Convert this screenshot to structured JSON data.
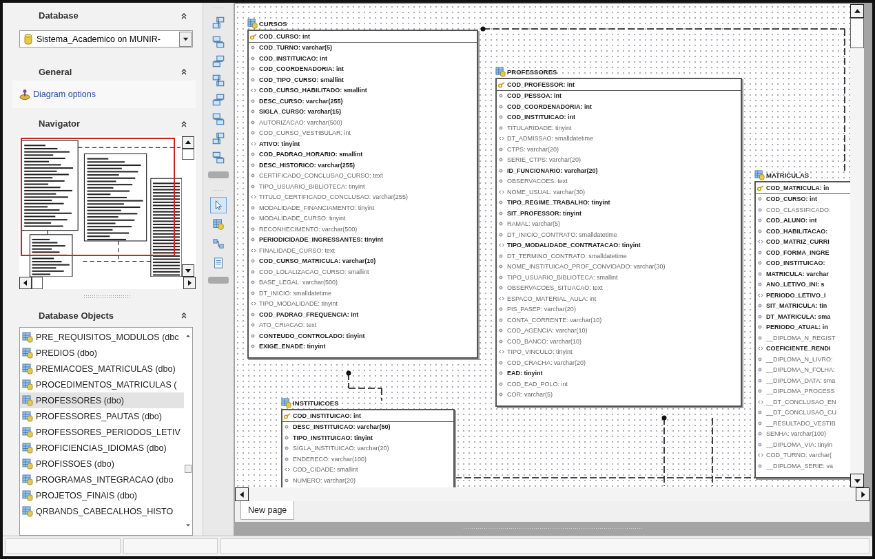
{
  "database_panel": {
    "title": "Database",
    "selected_database": "Sistema_Academico on MUNIR-"
  },
  "general_panel": {
    "title": "General",
    "link": "Diagram options"
  },
  "navigator_panel": {
    "title": "Navigator"
  },
  "objects_panel": {
    "title": "Database Objects",
    "items": [
      {
        "label": "PRE_REQUISITOS_MODULOS (dbc",
        "selected": false
      },
      {
        "label": "PREDIOS (dbo)",
        "selected": false
      },
      {
        "label": "PREMIACOES_MATRICULAS (dbo)",
        "selected": false
      },
      {
        "label": "PROCEDIMENTOS_MATRICULAS (",
        "selected": false
      },
      {
        "label": "PROFESSORES (dbo)",
        "selected": true
      },
      {
        "label": "PROFESSORES_PAUTAS (dbo)",
        "selected": false
      },
      {
        "label": "PROFESSORES_PERIODOS_LETIV",
        "selected": false
      },
      {
        "label": "PROFICIENCIAS_IDIOMAS (dbo)",
        "selected": false
      },
      {
        "label": "PROFISSOES (dbo)",
        "selected": false
      },
      {
        "label": "PROGRAMAS_INTEGRACAO (dbo",
        "selected": false
      },
      {
        "label": "PROJETOS_FINAIS (dbo)",
        "selected": false
      },
      {
        "label": "QRBANDS_CABECALHOS_HISTO",
        "selected": false
      }
    ]
  },
  "tools": [
    {
      "kind": "pointer",
      "selected": true
    },
    {
      "kind": "table",
      "selected": false
    },
    {
      "kind": "relation",
      "selected": false
    },
    {
      "kind": "note",
      "selected": false
    }
  ],
  "diagram": {
    "tables": [
      {
        "name": "CURSOS",
        "fields": [
          {
            "text": "COD_CURSO: int",
            "kind": "key",
            "bold": true
          },
          {
            "text": "COD_TURNO: varchar(5)",
            "kind": "dot",
            "bold": true
          },
          {
            "text": "COD_INSTITUICAO: int",
            "kind": "dot",
            "bold": true
          },
          {
            "text": "COD_COORDENADORIA: int",
            "kind": "dot",
            "bold": true
          },
          {
            "text": "COD_TIPO_CURSO: smallint",
            "kind": "dot",
            "bold": true
          },
          {
            "text": "COD_CURSO_HABILITADO: smallint",
            "kind": "chevrons",
            "bold": true
          },
          {
            "text": "DESC_CURSO: varchar(255)",
            "kind": "dot",
            "bold": true
          },
          {
            "text": "SIGLA_CURSO: varchar(15)",
            "kind": "dot",
            "bold": true
          },
          {
            "text": "AUTORIZACAO: varchar(500)",
            "kind": "dot",
            "bold": false
          },
          {
            "text": "COD_CURSO_VESTIBULAR: int",
            "kind": "dot",
            "bold": false
          },
          {
            "text": "ATIVO: tinyint",
            "kind": "chevrons",
            "bold": true
          },
          {
            "text": "COD_PADRAO_HORARIO: smallint",
            "kind": "dot",
            "bold": true
          },
          {
            "text": "DESC_HISTORICO: varchar(255)",
            "kind": "dot",
            "bold": true
          },
          {
            "text": "CERTIFICADO_CONCLUSAO_CURSO: text",
            "kind": "dot",
            "bold": false
          },
          {
            "text": "TIPO_USUARIO_BIBLIOTECA: tinyint",
            "kind": "dot",
            "bold": false
          },
          {
            "text": "TITULO_CERTIFICADO_CONCLUSAO: varchar(255)",
            "kind": "chevrons",
            "bold": false
          },
          {
            "text": "MODALIDADE_FINANCIAMENTO: tinyint",
            "kind": "dot",
            "bold": false
          },
          {
            "text": "MODALIDADE_CURSO: tinyint",
            "kind": "dot",
            "bold": false
          },
          {
            "text": "RECONHECIMENTO: varchar(500)",
            "kind": "dot",
            "bold": false
          },
          {
            "text": "PERIODICIDADE_INGRESSANTES: tinyint",
            "kind": "dot",
            "bold": true
          },
          {
            "text": "FINALIDADE_CURSO: text",
            "kind": "chevrons",
            "bold": false
          },
          {
            "text": "COD_CURSO_MATRICULA: varchar(10)",
            "kind": "dot",
            "bold": true
          },
          {
            "text": "COD_LOLALIZACAO_CURSO: smallint",
            "kind": "dot",
            "bold": false
          },
          {
            "text": "BASE_LEGAL: varchar(500)",
            "kind": "dot",
            "bold": false
          },
          {
            "text": "DT_INICIO: smalldatetime",
            "kind": "dot",
            "bold": false
          },
          {
            "text": "TIPO_MODALIDADE: tinyint",
            "kind": "chevrons",
            "bold": false
          },
          {
            "text": "COD_PADRAO_FREQUENCIA: int",
            "kind": "dot",
            "bold": true
          },
          {
            "text": "ATO_CRIACAO: text",
            "kind": "dot",
            "bold": false
          },
          {
            "text": "CONTEUDO_CONTROLADO: tinyint",
            "kind": "dot",
            "bold": true
          },
          {
            "text": "EXIGE_ENADE: tinyint",
            "kind": "dot",
            "bold": true
          }
        ]
      },
      {
        "name": "PROFESSORES",
        "fields": [
          {
            "text": "COD_PROFESSOR: int",
            "kind": "key",
            "bold": true
          },
          {
            "text": "COD_PESSOA: int",
            "kind": "dot",
            "bold": true
          },
          {
            "text": "COD_COORDENADORIA: int",
            "kind": "dot",
            "bold": true
          },
          {
            "text": "COD_INSTITUICAO: int",
            "kind": "dot",
            "bold": true
          },
          {
            "text": "TITULARIDADE: tinyint",
            "kind": "dot",
            "bold": false
          },
          {
            "text": "DT_ADMISSAO: smalldatetime",
            "kind": "chevrons",
            "bold": false
          },
          {
            "text": "CTPS: varchar(20)",
            "kind": "dot",
            "bold": false
          },
          {
            "text": "SERIE_CTPS: varchar(20)",
            "kind": "dot",
            "bold": false
          },
          {
            "text": "ID_FUNCIONARIO: varchar(20)",
            "kind": "dot",
            "bold": true
          },
          {
            "text": "OBSERVACOES: text",
            "kind": "dot",
            "bold": false
          },
          {
            "text": "NOME_USUAL: varchar(30)",
            "kind": "chevrons",
            "bold": false
          },
          {
            "text": "TIPO_REGIME_TRABALHO: tinyint",
            "kind": "dot",
            "bold": true
          },
          {
            "text": "SIT_PROFESSOR: tinyint",
            "kind": "dot",
            "bold": true
          },
          {
            "text": "RAMAL: varchar(5)",
            "kind": "dot",
            "bold": false
          },
          {
            "text": "DT_INICIO_CONTRATO: smalldatetime",
            "kind": "dot",
            "bold": false
          },
          {
            "text": "TIPO_MODALIDADE_CONTRATACAO: tinyint",
            "kind": "chevrons",
            "bold": true
          },
          {
            "text": "DT_TERMINO_CONTRATO: smalldatetime",
            "kind": "dot",
            "bold": false
          },
          {
            "text": "NOME_INSTITUICAO_PROF_CONVIDADO: varchar(30)",
            "kind": "dot",
            "bold": false
          },
          {
            "text": "TIPO_USUARIO_BIBLIOTECA: smallint",
            "kind": "dot",
            "bold": false
          },
          {
            "text": "OBSERVACOES_SITUACAO: text",
            "kind": "dot",
            "bold": false
          },
          {
            "text": "ESPACO_MATERIAL_AULA: int",
            "kind": "chevrons",
            "bold": false
          },
          {
            "text": "PIS_PASEP: varchar(20)",
            "kind": "dot",
            "bold": false
          },
          {
            "text": "CONTA_CORRENTE: varchar(10)",
            "kind": "dot",
            "bold": false
          },
          {
            "text": "COD_AGENCIA: varchar(10)",
            "kind": "dot",
            "bold": false
          },
          {
            "text": "COD_BANCO: varchar(10)",
            "kind": "dot",
            "bold": false
          },
          {
            "text": "TIPO_VINCULO: tinyint",
            "kind": "chevrons",
            "bold": false
          },
          {
            "text": "COD_CRACHA: varchar(20)",
            "kind": "dot",
            "bold": false
          },
          {
            "text": "EAD: tinyint",
            "kind": "dot",
            "bold": true
          },
          {
            "text": "COD_EAD_POLO: int",
            "kind": "dot",
            "bold": false
          },
          {
            "text": "COR: varchar(5)",
            "kind": "dot",
            "bold": false
          }
        ]
      },
      {
        "name": "MATRICULAS",
        "fields": [
          {
            "text": "COD_MATRICULA: in",
            "kind": "key",
            "bold": true
          },
          {
            "text": "COD_CURSO: int",
            "kind": "dot",
            "bold": true
          },
          {
            "text": "COD_CLASSIFICADO:",
            "kind": "dot",
            "bold": false
          },
          {
            "text": "COD_ALUNO: int",
            "kind": "dot",
            "bold": true
          },
          {
            "text": "COD_HABILITACAO:",
            "kind": "dot",
            "bold": true
          },
          {
            "text": "COD_MATRIZ_CURRI",
            "kind": "chevrons",
            "bold": true
          },
          {
            "text": "COD_FORMA_INGRE",
            "kind": "dot",
            "bold": true
          },
          {
            "text": "COD_INSTITUICAO:",
            "kind": "dot",
            "bold": true
          },
          {
            "text": "MATRICULA: varchar",
            "kind": "dot",
            "bold": true
          },
          {
            "text": "ANO_LETIVO_INI: s",
            "kind": "dot",
            "bold": true
          },
          {
            "text": "PERIODO_LETIVO_I",
            "kind": "chevrons",
            "bold": true
          },
          {
            "text": "SIT_MATRICULA: tin",
            "kind": "dot",
            "bold": true
          },
          {
            "text": "DT_MATRICULA: sma",
            "kind": "dot",
            "bold": true
          },
          {
            "text": "PERIODO_ATUAL: in",
            "kind": "dot",
            "bold": true
          },
          {
            "text": "__DIPLOMA_N_REGIST",
            "kind": "dot",
            "bold": false
          },
          {
            "text": "COEFICIENTE_RENDI",
            "kind": "chevrons",
            "bold": true
          },
          {
            "text": "__DIPLOMA_N_LIVRO:",
            "kind": "dot",
            "bold": false
          },
          {
            "text": "__DIPLOMA_N_FOLHA:",
            "kind": "dot",
            "bold": false
          },
          {
            "text": "__DIPLOMA_DATA: sma",
            "kind": "dot",
            "bold": false
          },
          {
            "text": "__DIPLOMA_PROCESS",
            "kind": "dot",
            "bold": false
          },
          {
            "text": "__DT_CONCLUSAO_EN",
            "kind": "chevrons",
            "bold": false
          },
          {
            "text": "__DT_CONCLUSAO_CU",
            "kind": "dot",
            "bold": false
          },
          {
            "text": "__RESULTADO_VESTIB",
            "kind": "dot",
            "bold": false
          },
          {
            "text": "SENHA: varchar(100)",
            "kind": "dot",
            "bold": false
          },
          {
            "text": "__DIPLOMA_VIA: tinyin",
            "kind": "dot",
            "bold": false
          },
          {
            "text": "COD_TURNO: varchar(",
            "kind": "chevrons",
            "bold": false
          },
          {
            "text": "__DIPLOMA_SERIE: va",
            "kind": "dot",
            "bold": false
          }
        ]
      },
      {
        "name": "INSTITUICOES",
        "fields": [
          {
            "text": "COD_INSTITUICAO: int",
            "kind": "key",
            "bold": true
          },
          {
            "text": "DESC_INSTITUICAO: varchar(50)",
            "kind": "dot",
            "bold": true
          },
          {
            "text": "TIPO_INSTITUICAO: tinyint",
            "kind": "dot",
            "bold": true
          },
          {
            "text": "SIGLA_INSTITUICAO: varchar(20)",
            "kind": "dot",
            "bold": false
          },
          {
            "text": "ENDERECO: varchar(100)",
            "kind": "dot",
            "bold": false
          },
          {
            "text": "COD_CIDADE: smallint",
            "kind": "chevrons",
            "bold": false
          },
          {
            "text": "NUMERO: varchar(20)",
            "kind": "dot",
            "bold": false
          }
        ]
      }
    ]
  },
  "tabs": [
    {
      "label": "New page",
      "selected": true
    }
  ]
}
